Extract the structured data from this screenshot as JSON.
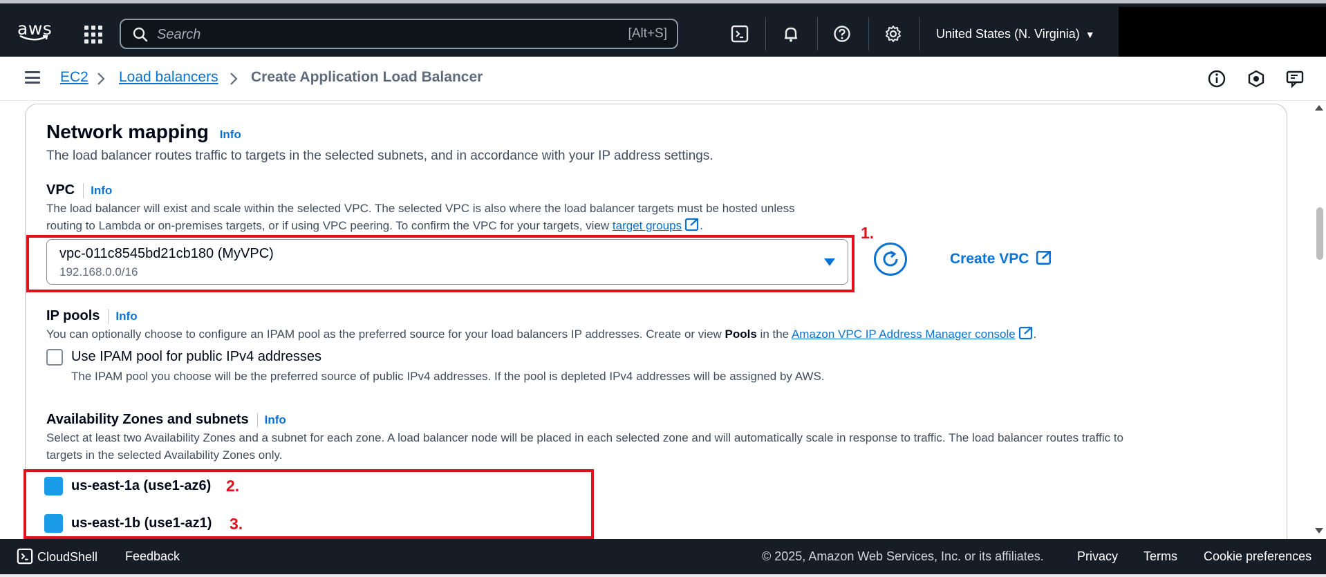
{
  "topnav": {
    "logo": "aws",
    "search_placeholder": "Search",
    "search_shortcut": "[Alt+S]",
    "region": "United States (N. Virginia)",
    "icons": [
      "cloudshell-icon",
      "bell-icon",
      "help-icon",
      "gear-icon"
    ]
  },
  "breadcrumb": {
    "items": [
      "EC2",
      "Load balancers"
    ],
    "current": "Create Application Load Balancer"
  },
  "network_mapping": {
    "title": "Network mapping",
    "info": "Info",
    "description": "The load balancer routes traffic to targets in the selected subnets, and in accordance with your IP address settings."
  },
  "vpc": {
    "label": "VPC",
    "info": "Info",
    "desc_line1": "The load balancer will exist and scale within the selected VPC. The selected VPC is also where the load balancer targets must be hosted unless",
    "desc_line2_prefix": "routing to Lambda or on-premises targets, or if using VPC peering. To confirm the VPC for your targets, view ",
    "desc_link": "target groups",
    "desc_suffix": ".",
    "selected_value": "vpc-011c8545bd21cb180 (MyVPC)",
    "selected_cidr": "192.168.0.0/16",
    "create_label": "Create VPC"
  },
  "ip_pools": {
    "label": "IP pools",
    "info": "Info",
    "desc_prefix": "You can optionally choose to configure an IPAM pool as the preferred source for your load balancers IP addresses. Create or view ",
    "desc_bold": "Pools",
    "desc_mid": " in the ",
    "desc_link": "Amazon VPC IP Address Manager console",
    "desc_suffix": ".",
    "checkbox_label": "Use IPAM pool for public IPv4 addresses",
    "checkbox_checked": false,
    "checkbox_desc": "The IPAM pool you choose will be the preferred source of public IPv4 addresses. If the pool is depleted IPv4 addresses will be assigned by AWS."
  },
  "az": {
    "label": "Availability Zones and subnets",
    "info": "Info",
    "desc_line1": "Select at least two Availability Zones and a subnet for each zone. A load balancer node will be placed in each selected zone and will automatically scale in response to traffic. The load balancer routes traffic to",
    "desc_line2": "targets in the selected Availability Zones only.",
    "zones": [
      {
        "name": "us-east-1a (use1-az6)",
        "checked": true
      },
      {
        "name": "us-east-1b (use1-az1)",
        "checked": true
      }
    ]
  },
  "annotations": [
    "1.",
    "2.",
    "3."
  ],
  "footer": {
    "cloudshell": "CloudShell",
    "feedback": "Feedback",
    "copyright": "© 2025, Amazon Web Services, Inc. or its affiliates.",
    "privacy": "Privacy",
    "terms": "Terms",
    "cookies": "Cookie preferences"
  },
  "colors": {
    "nav_bg": "#161d26",
    "link": "#0972d3",
    "annotation_red": "#e0111b",
    "checkbox_checked": "#1a9be8"
  }
}
